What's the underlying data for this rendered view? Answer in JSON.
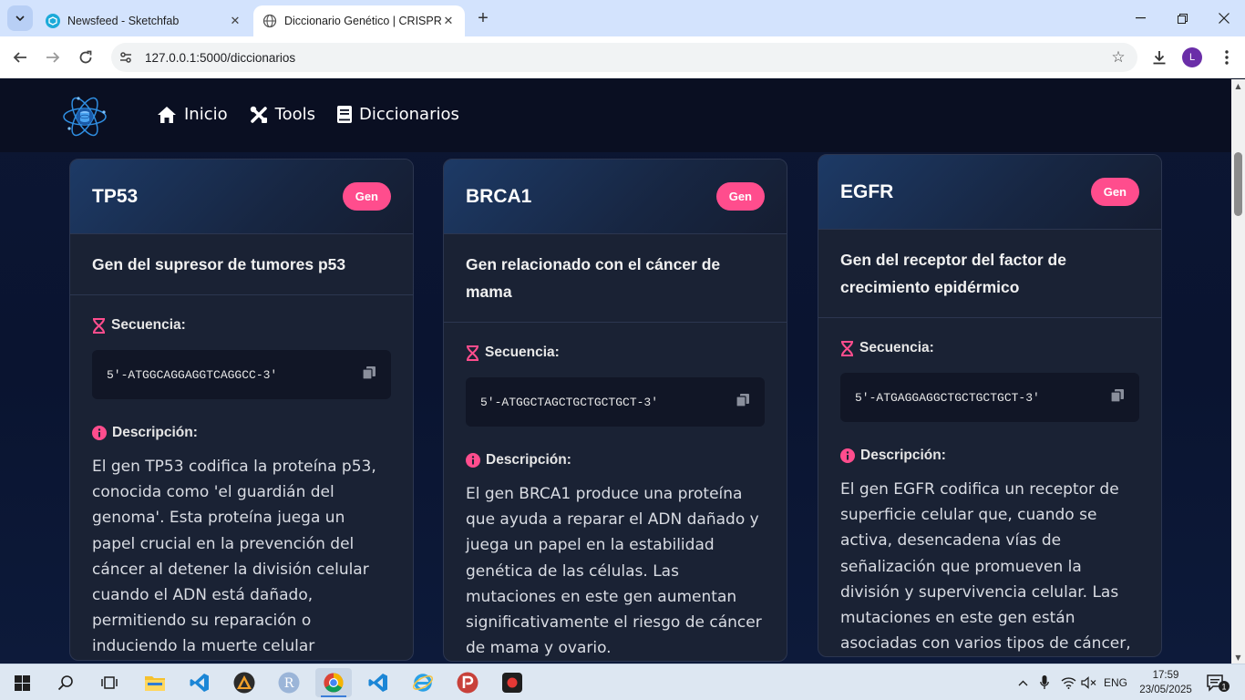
{
  "browser": {
    "tabs": [
      {
        "title": "Newsfeed - Sketchfab",
        "active": false,
        "favicon": "sketchfab-icon"
      },
      {
        "title": "Diccionario Genético | CRISPR T",
        "active": true,
        "favicon": "globe-icon"
      }
    ],
    "url": "127.0.0.1:5000/diccionarios",
    "profile_initial": "L"
  },
  "site": {
    "nav": [
      {
        "label": "Inicio",
        "icon": "home-icon"
      },
      {
        "label": "Tools",
        "icon": "tools-icon"
      },
      {
        "label": "Diccionarios",
        "icon": "book-icon"
      }
    ]
  },
  "labels": {
    "sequence": "Secuencia:",
    "description": "Descripción:"
  },
  "cards": [
    {
      "title": "TP53",
      "badge": "Gen",
      "subtitle": "Gen del supresor de tumores p53",
      "sequence": "5'-ATGGCAGGAGGTCAGGCC-3'",
      "description": "El gen TP53 codifica la proteína p53, conocida como 'el guardián del genoma'. Esta proteína juega un papel crucial en la prevención del cáncer al detener la división celular cuando el ADN está dañado, permitiendo su reparación o induciendo la muerte celular"
    },
    {
      "title": "BRCA1",
      "badge": "Gen",
      "subtitle": "Gen relacionado con el cáncer de mama",
      "sequence": "5'-ATGGCTAGCTGCTGCTGCT-3'",
      "description": "El gen BRCA1 produce una proteína que ayuda a reparar el ADN dañado y juega un papel en la estabilidad genética de las células. Las mutaciones en este gen aumentan significativamente el riesgo de cáncer de mama y ovario."
    },
    {
      "title": "EGFR",
      "badge": "Gen",
      "subtitle": "Gen del receptor del factor de crecimiento epidérmico",
      "sequence": "5'-ATGAGGAGGCTGCTGCTGCT-3'",
      "description": "El gen EGFR codifica un receptor de superficie celular que, cuando se activa, desencadena vías de señalización que promueven la división y supervivencia celular. Las mutaciones en este gen están asociadas con varios tipos de cáncer,"
    }
  ],
  "taskbar": {
    "language": "ENG",
    "time": "17:59",
    "date": "23/05/2025",
    "notifications": "1"
  },
  "colors": {
    "accent_pink": "#ff4d8d",
    "page_bg": "#0b1329",
    "card_bg": "#1a2234"
  }
}
